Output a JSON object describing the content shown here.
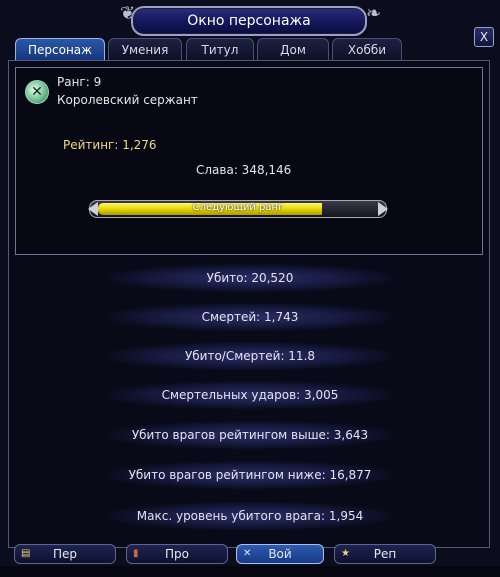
{
  "window": {
    "title": "Окно персонажа",
    "close_label": "X"
  },
  "tabs": [
    {
      "label": "Персонаж",
      "active": true
    },
    {
      "label": "Умения",
      "active": false
    },
    {
      "label": "Титул",
      "active": false
    },
    {
      "label": "Дом",
      "active": false
    },
    {
      "label": "Хобби",
      "active": false
    }
  ],
  "profile": {
    "rank_label": "Ранг: 9",
    "rank_title": "Королевский сержант",
    "rating": "Рейтинг: 1,276",
    "fame": "Слава: 348,146",
    "progress": {
      "label": "Следующий ранг",
      "fraction": 0.8
    }
  },
  "stats": [
    "Убито: 20,520",
    "Смертей: 1,743",
    "Убито/Смертей: 11.8",
    "Смертельных ударов: 3,005",
    "Убито врагов рейтингом выше: 3,643",
    "Убито врагов рейтингом ниже: 16,877",
    "Макс. уровень убитого врага: 1,954"
  ],
  "bottom_tabs": [
    {
      "label": "Пер",
      "icon": "book-icon"
    },
    {
      "label": "Про",
      "icon": "scroll-icon"
    },
    {
      "label": "Вой",
      "icon": "crossed-swords-icon",
      "active": true
    },
    {
      "label": "Реп",
      "icon": "star-icon"
    }
  ],
  "colors": {
    "accent": "#f0d98c",
    "tab_active": "#2a58a8",
    "bar_fill": "#e3d100"
  }
}
